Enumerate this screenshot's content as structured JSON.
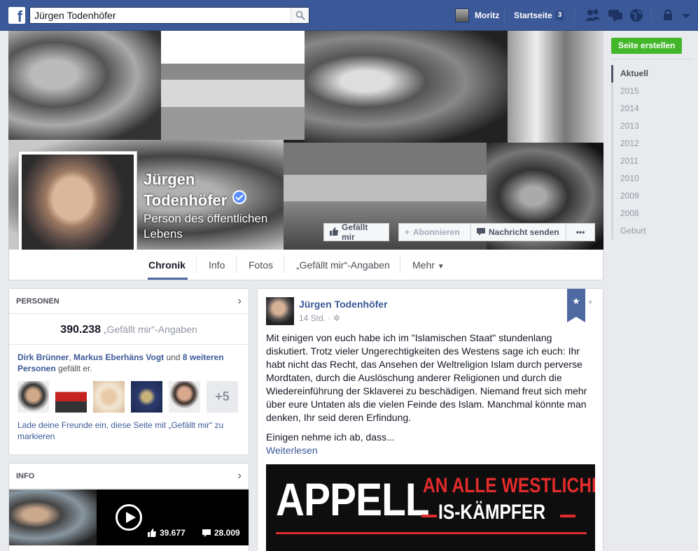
{
  "topbar": {
    "search_value": "Jürgen Todenhöfer",
    "user_name": "Moritz",
    "home_label": "Startseite",
    "home_count": "3"
  },
  "cover": {
    "name_line1": "Jürgen",
    "name_line2": "Todenhöfer",
    "category": "Person des öffentlichen Lebens",
    "buttons": {
      "like": "Gefällt mir",
      "subscribe": "Abonnieren",
      "message": "Nachricht senden",
      "more": "•••"
    }
  },
  "tabs": [
    "Chronik",
    "Info",
    "Fotos",
    "„Gefällt mir“-Angaben",
    "Mehr"
  ],
  "right": {
    "create_page": "Seite erstellen",
    "years": [
      "Aktuell",
      "2015",
      "2014",
      "2013",
      "2012",
      "2011",
      "2010",
      "2009",
      "2008",
      "Geburt"
    ]
  },
  "people": {
    "title": "PERSONEN",
    "likes_count": "390.238",
    "likes_label": "„Gefällt mir“-Angaben",
    "friend1": "Dirk Brünner",
    "friend2": "Markus Eberhäns Vogt",
    "and": "und",
    "others": "8 weiteren Personen",
    "tail": "gefällt er.",
    "plus": "+5",
    "invite": "Lade deine Freunde ein, diese Seite mit „Gefällt mir“ zu markieren"
  },
  "info": {
    "title": "INFO",
    "video_likes": "39.677",
    "video_comments": "28.009"
  },
  "post": {
    "author": "Jürgen Todenhöfer",
    "time": "14 Std. ·",
    "text": "Mit einigen von euch habe ich im \"Islamischen Staat\" stundenlang diskutiert. Trotz vieler Ungerechtigkeiten des Westens sage ich euch: Ihr habt nicht das Recht, das Ansehen der Weltreligion Islam durch perverse Mordtaten, durch die Auslöschung anderer Religionen und durch die Wiedereinführung der Sklaverei zu beschädigen. Niemand freut sich mehr über eure Untaten als die vielen Feinde des Islam. Manchmal könnte man denken, Ihr seid deren Erfindung.",
    "continue": "Einigen nehme ich ab, dass...",
    "read_more": "Weiterlesen",
    "image_big": "APPELL",
    "image_line1": "AN ALLE WESTLICHEN",
    "image_line2": "IS-KÄMPFER"
  },
  "colors": {
    "topbar": "#3b5998",
    "link": "#3b5998",
    "create_button": "#42b72a",
    "image_red": "#e32b2b"
  }
}
